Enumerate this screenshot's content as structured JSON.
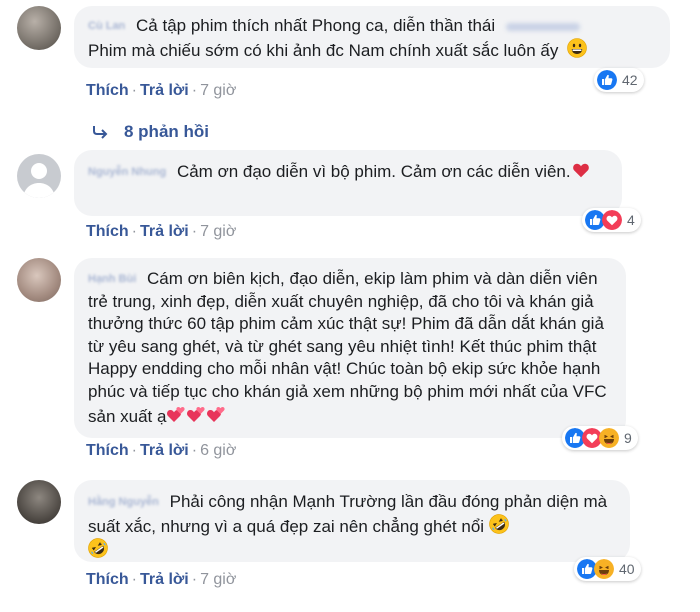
{
  "comments": [
    {
      "author": "Cù Lan",
      "text": "Cả tập phim thích nhất Phong ca, diễn thần thái",
      "text_line2": "Phim mà chiếu sớm có khi ảnh đc Nam chính xuất sắc luôn ấy",
      "reaction_count": "42",
      "like_label": "Thích",
      "reply_label": "Trả lời",
      "time": "7 giờ",
      "replies_label": "8 phản hồi"
    },
    {
      "author": "Nguyễn Nhung",
      "text": "Cảm ơn đạo diễn vì bộ phim. Cảm ơn các diễn viên.",
      "reaction_count": "4",
      "like_label": "Thích",
      "reply_label": "Trả lời",
      "time": "7 giờ"
    },
    {
      "author": "Hạnh Bùi",
      "text": "Cám ơn biên kịch, đạo diễn, ekip làm phim và dàn diễn viên trẻ trung, xinh đẹp, diễn xuất chuyên nghiệp, đã cho tôi và khán giả thưởng thức 60 tập phim cảm xúc thật sự! Phim đã dẫn dắt khán giả từ yêu sang ghét, và từ ghét sang yêu nhiệt tình! Kết thúc phim thật Happy endding cho mỗi nhân vật! Chúc toàn bộ ekip sức khỏe hạnh phúc và tiếp tục cho khán giả xem những bộ phim mới nhất của VFC sản xuất ạ",
      "reaction_count": "9",
      "like_label": "Thích",
      "reply_label": "Trả lời",
      "time": "6 giờ"
    },
    {
      "author": "Hằng Nguyễn",
      "text": "Phải công nhận Mạnh Trường lần đầu đóng phản diện mà suất xắc, nhưng vì a quá đẹp zai nên chẳng ghét nổi",
      "reaction_count": "40",
      "like_label": "Thích",
      "reply_label": "Trả lời",
      "time": "7 giờ"
    }
  ],
  "colors": {
    "link": "#385898",
    "meta": "#90949c",
    "bubble": "#f2f3f5",
    "like_blue": "#1877f2",
    "love_red": "#f33e58",
    "haha_yellow": "#f7b125"
  },
  "icons": [
    "like-icon",
    "love-icon",
    "haha-icon",
    "grin-emoji",
    "heart-emoji",
    "two-hearts-emoji",
    "rofl-emoji",
    "reply-arrow-icon"
  ]
}
